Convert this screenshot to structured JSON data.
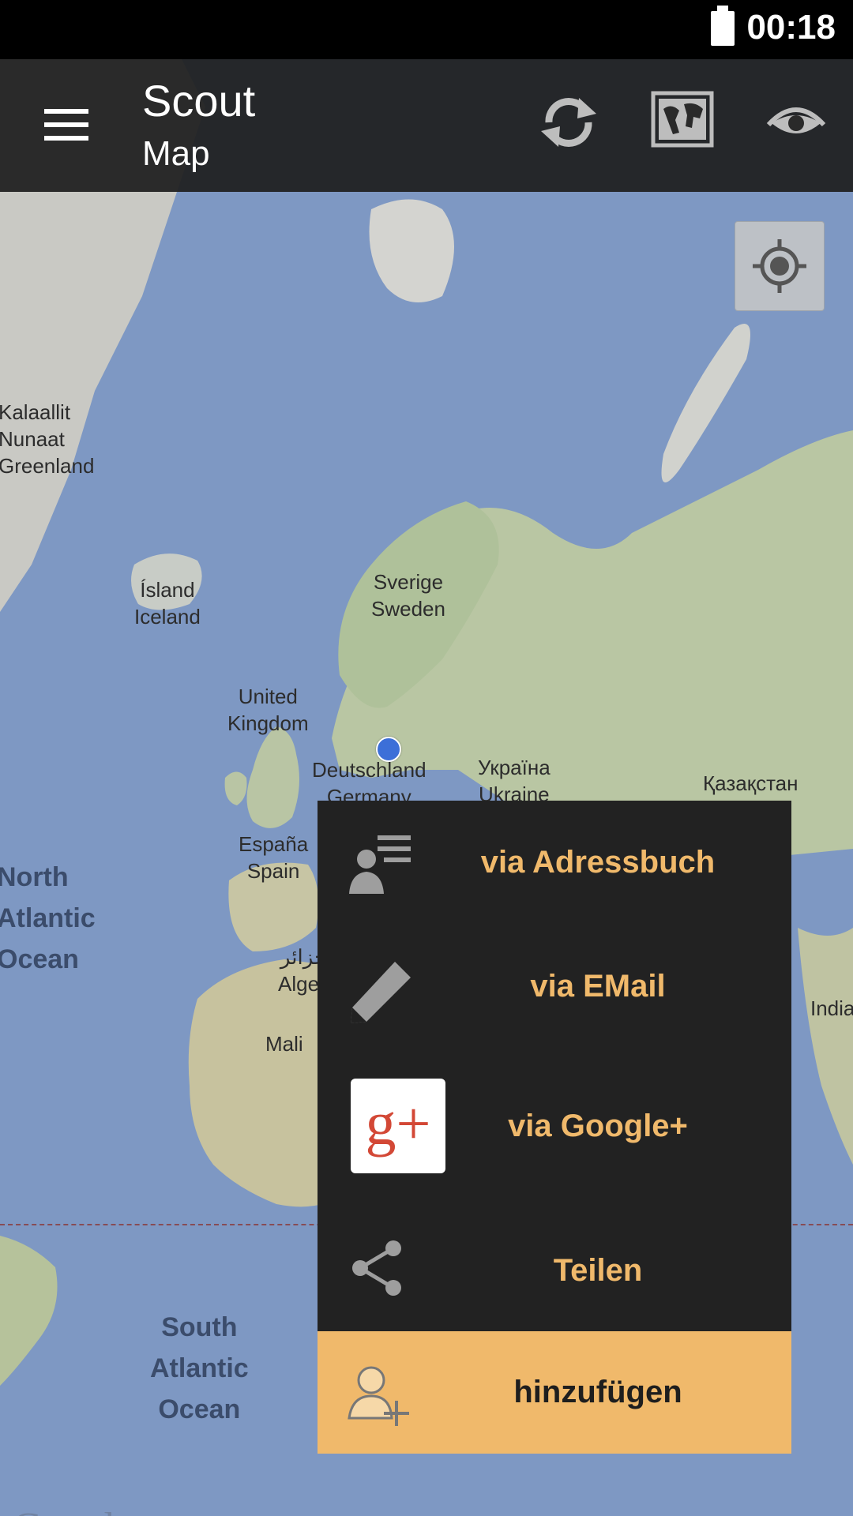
{
  "status_bar": {
    "time": "00:18"
  },
  "app_bar": {
    "title": "Scout",
    "subtitle": "Map",
    "icons": [
      "menu-icon",
      "refresh-icon",
      "map-view-icon",
      "eye-icon"
    ]
  },
  "map": {
    "labels": {
      "greenland": "Kalaallit\nNunaat\nGreenland",
      "iceland": "Ísland\nIceland",
      "sweden": "Sverige\nSweden",
      "uk": "United\nKingdom",
      "germany": "Deutschland\nGermany",
      "ukraine": "Україна\nUkraine",
      "kazakhstan": "Қазақстан",
      "spain": "España\nSpain",
      "algeria": "الجزائر\nAlgeria",
      "mali": "Mali",
      "india": "India",
      "north_atlantic": "North\nAtlantic\nOcean",
      "south_atlantic": "South\nAtlantic\nOcean"
    },
    "attribution": "Google"
  },
  "share_menu": {
    "items": [
      {
        "label": "via Adressbuch",
        "icon": "contact-list-icon"
      },
      {
        "label": "via EMail",
        "icon": "pencil-icon"
      },
      {
        "label": "via Google+",
        "icon": "google-plus-icon",
        "icon_text": "g+"
      },
      {
        "label": "Teilen",
        "icon": "share-icon"
      },
      {
        "label": "hinzufügen",
        "icon": "add-person-icon"
      }
    ]
  },
  "colors": {
    "accent": "#F0B96B",
    "menu_background": "#222222",
    "app_bar": "#1E1E1E",
    "location_dot": "#3C6FD8"
  }
}
